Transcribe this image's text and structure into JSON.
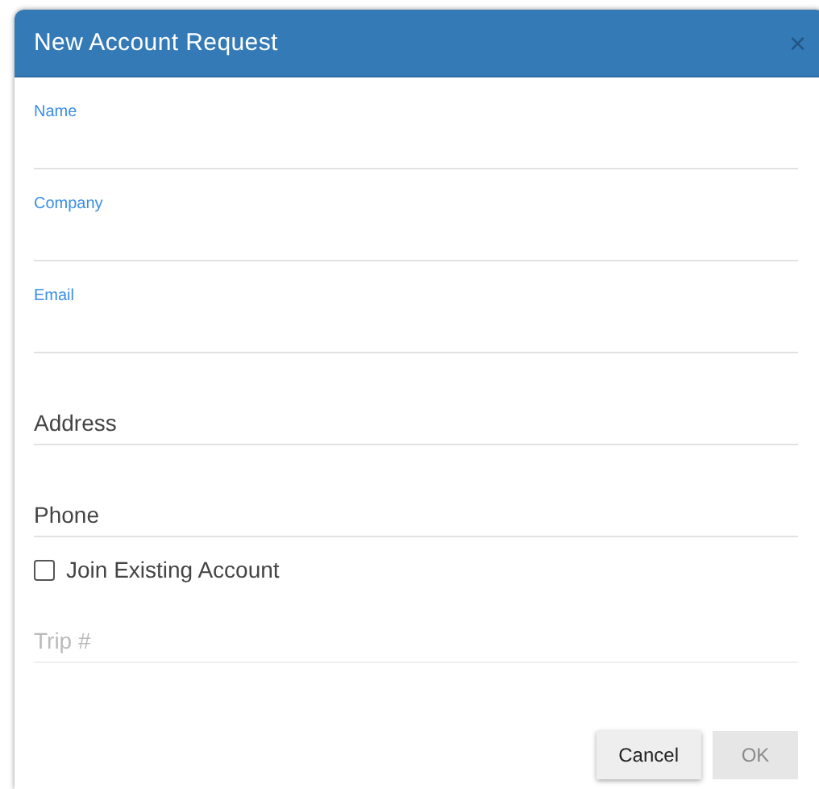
{
  "dialog": {
    "title": "New Account Request",
    "close": "×"
  },
  "fields": [
    {
      "label": "Name",
      "floated": true,
      "disabled": false
    },
    {
      "label": "Company",
      "floated": true,
      "disabled": false
    },
    {
      "label": "Email",
      "floated": true,
      "disabled": false
    },
    {
      "label": "Address",
      "floated": false,
      "disabled": false
    },
    {
      "label": "Phone",
      "floated": false,
      "disabled": false
    }
  ],
  "checkbox": {
    "label": "Join Existing Account",
    "checked": false
  },
  "trip_field": {
    "label": "Trip #",
    "floated": false,
    "disabled": true
  },
  "buttons": [
    {
      "label": "Cancel",
      "disabled": false
    },
    {
      "label": "OK",
      "disabled": true
    }
  ]
}
